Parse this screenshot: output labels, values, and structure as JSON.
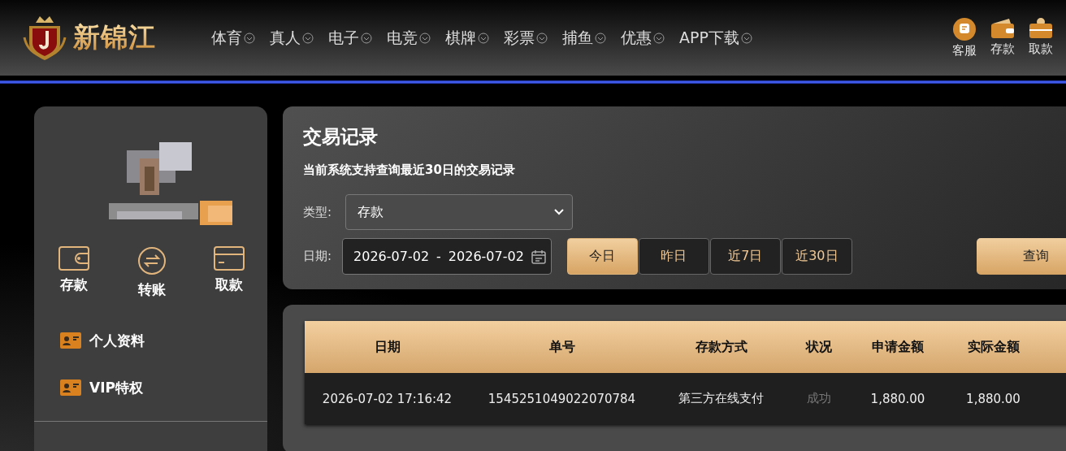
{
  "header": {
    "logo_text": "新锦江",
    "nav": [
      {
        "label": "体育"
      },
      {
        "label": "真人"
      },
      {
        "label": "电子"
      },
      {
        "label": "电竞"
      },
      {
        "label": "棋牌"
      },
      {
        "label": "彩票"
      },
      {
        "label": "捕鱼"
      },
      {
        "label": "优惠"
      },
      {
        "label": "APP下载"
      }
    ],
    "actions": [
      {
        "kind": "service",
        "label": "客服"
      },
      {
        "kind": "deposit",
        "label": "存款"
      },
      {
        "kind": "withdraw",
        "label": "取款"
      }
    ]
  },
  "sidebar": {
    "quick_actions": [
      {
        "kind": "wallet",
        "label": "存款"
      },
      {
        "kind": "transfer",
        "label": "转账"
      },
      {
        "kind": "card",
        "label": "取款"
      }
    ],
    "menu": [
      {
        "label": "个人资料"
      },
      {
        "label": "VIP特权"
      }
    ]
  },
  "filter": {
    "title": "交易记录",
    "note": "当前系统支持查询最近30日的交易记录",
    "type_label": "类型:",
    "type_value": "存款",
    "date_label": "日期:",
    "date_from": "2026-07-02",
    "date_sep": "-",
    "date_to": "2026-07-02",
    "ranges": [
      {
        "label": "今日",
        "selected": true
      },
      {
        "label": "昨日",
        "selected": false
      },
      {
        "label": "近7日",
        "selected": false
      },
      {
        "label": "近30日",
        "selected": false
      }
    ],
    "query_button": "查询"
  },
  "table": {
    "columns": [
      "日期",
      "单号",
      "存款方式",
      "状况",
      "申请金额",
      "实际金额"
    ],
    "rows": [
      {
        "date": "2026-07-02 17:16:42",
        "order": "1545251049022070784",
        "method": "第三方在线支付",
        "status": "成功",
        "requested": "1,880.00",
        "actual": "1,880.00"
      }
    ]
  }
}
